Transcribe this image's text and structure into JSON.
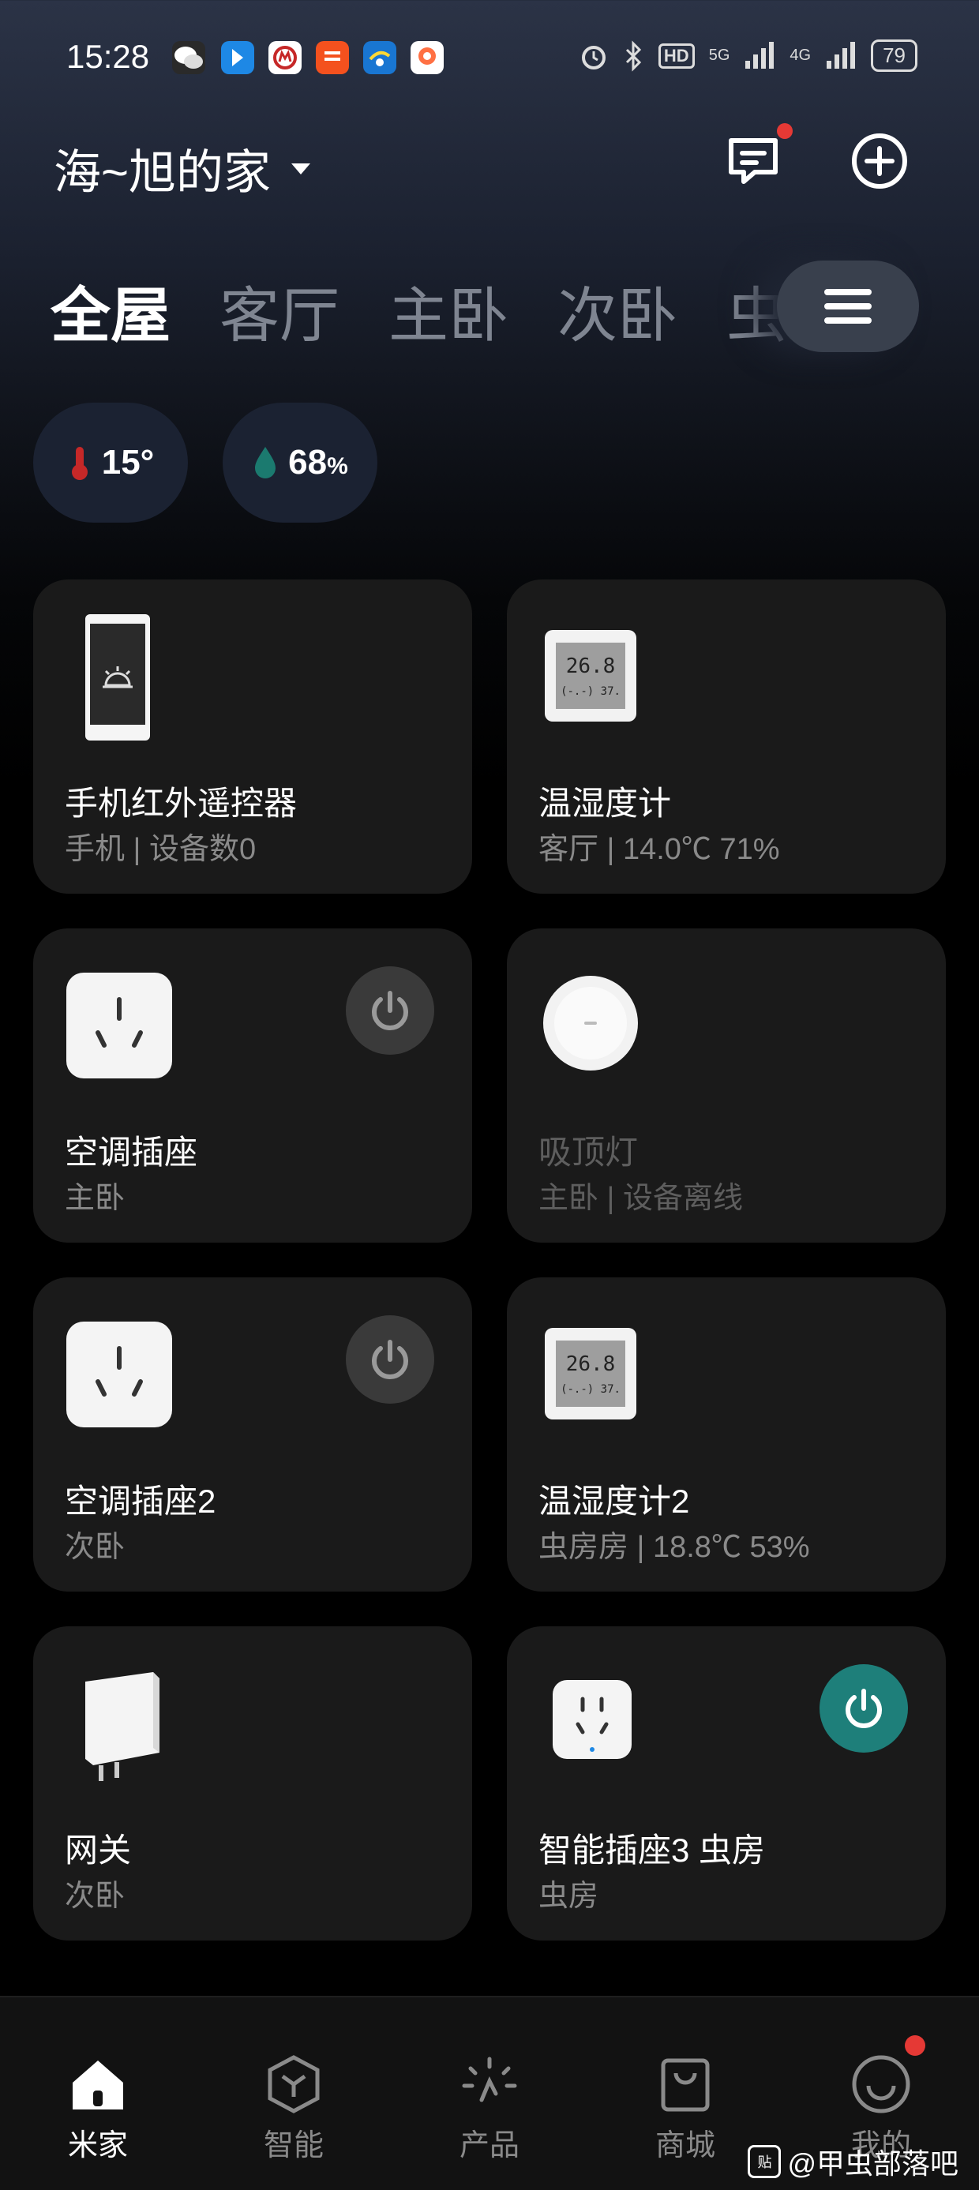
{
  "status_bar": {
    "time": "15:28",
    "battery": "79",
    "network": "5G",
    "network2": "4G",
    "hd_label": "HD"
  },
  "header": {
    "home_name": "海~旭的家"
  },
  "tabs": [
    "全屋",
    "客厅",
    "主卧",
    "次卧",
    "虫"
  ],
  "environment": {
    "temperature": "15°",
    "humidity": "68",
    "humidity_unit": "%"
  },
  "devices": [
    {
      "name": "手机红外遥控器",
      "sub": "手机 | 设备数0",
      "icon": "phone-ir-icon"
    },
    {
      "name": "温湿度计",
      "sub": "客厅 | 14.0℃ 71%",
      "icon": "thermo-hygrometer-icon"
    },
    {
      "name": "空调插座",
      "sub": "主卧",
      "icon": "ac-socket-icon",
      "power": "off"
    },
    {
      "name": "吸顶灯",
      "sub": "主卧 | 设备离线",
      "icon": "ceiling-light-icon",
      "offline": true
    },
    {
      "name": "空调插座2",
      "sub": "次卧",
      "icon": "ac-socket-icon",
      "power": "off"
    },
    {
      "name": "温湿度计2",
      "sub": "虫房房 | 18.8℃ 53%",
      "icon": "thermo-hygrometer-icon"
    },
    {
      "name": "网关",
      "sub": "次卧",
      "icon": "gateway-icon"
    },
    {
      "name": "智能插座3 虫房",
      "sub": "虫房",
      "icon": "smart-plug-icon",
      "power": "on"
    }
  ],
  "thermo_display": {
    "line1": "26.8",
    "line2": "(-.-) 37."
  },
  "bottom_nav": [
    {
      "label": "米家",
      "icon": "home-icon",
      "active": true
    },
    {
      "label": "智能",
      "icon": "smart-icon"
    },
    {
      "label": "产品",
      "icon": "product-icon"
    },
    {
      "label": "商城",
      "icon": "shop-icon"
    },
    {
      "label": "我的",
      "icon": "profile-icon"
    }
  ],
  "watermark": "@甲虫部落吧",
  "watermark_badge": "贴",
  "colors": {
    "power_on": "#1e7f7a",
    "notification": "#e53935",
    "temp_icon": "#c62828",
    "humidity_icon": "#1b7a6f"
  }
}
